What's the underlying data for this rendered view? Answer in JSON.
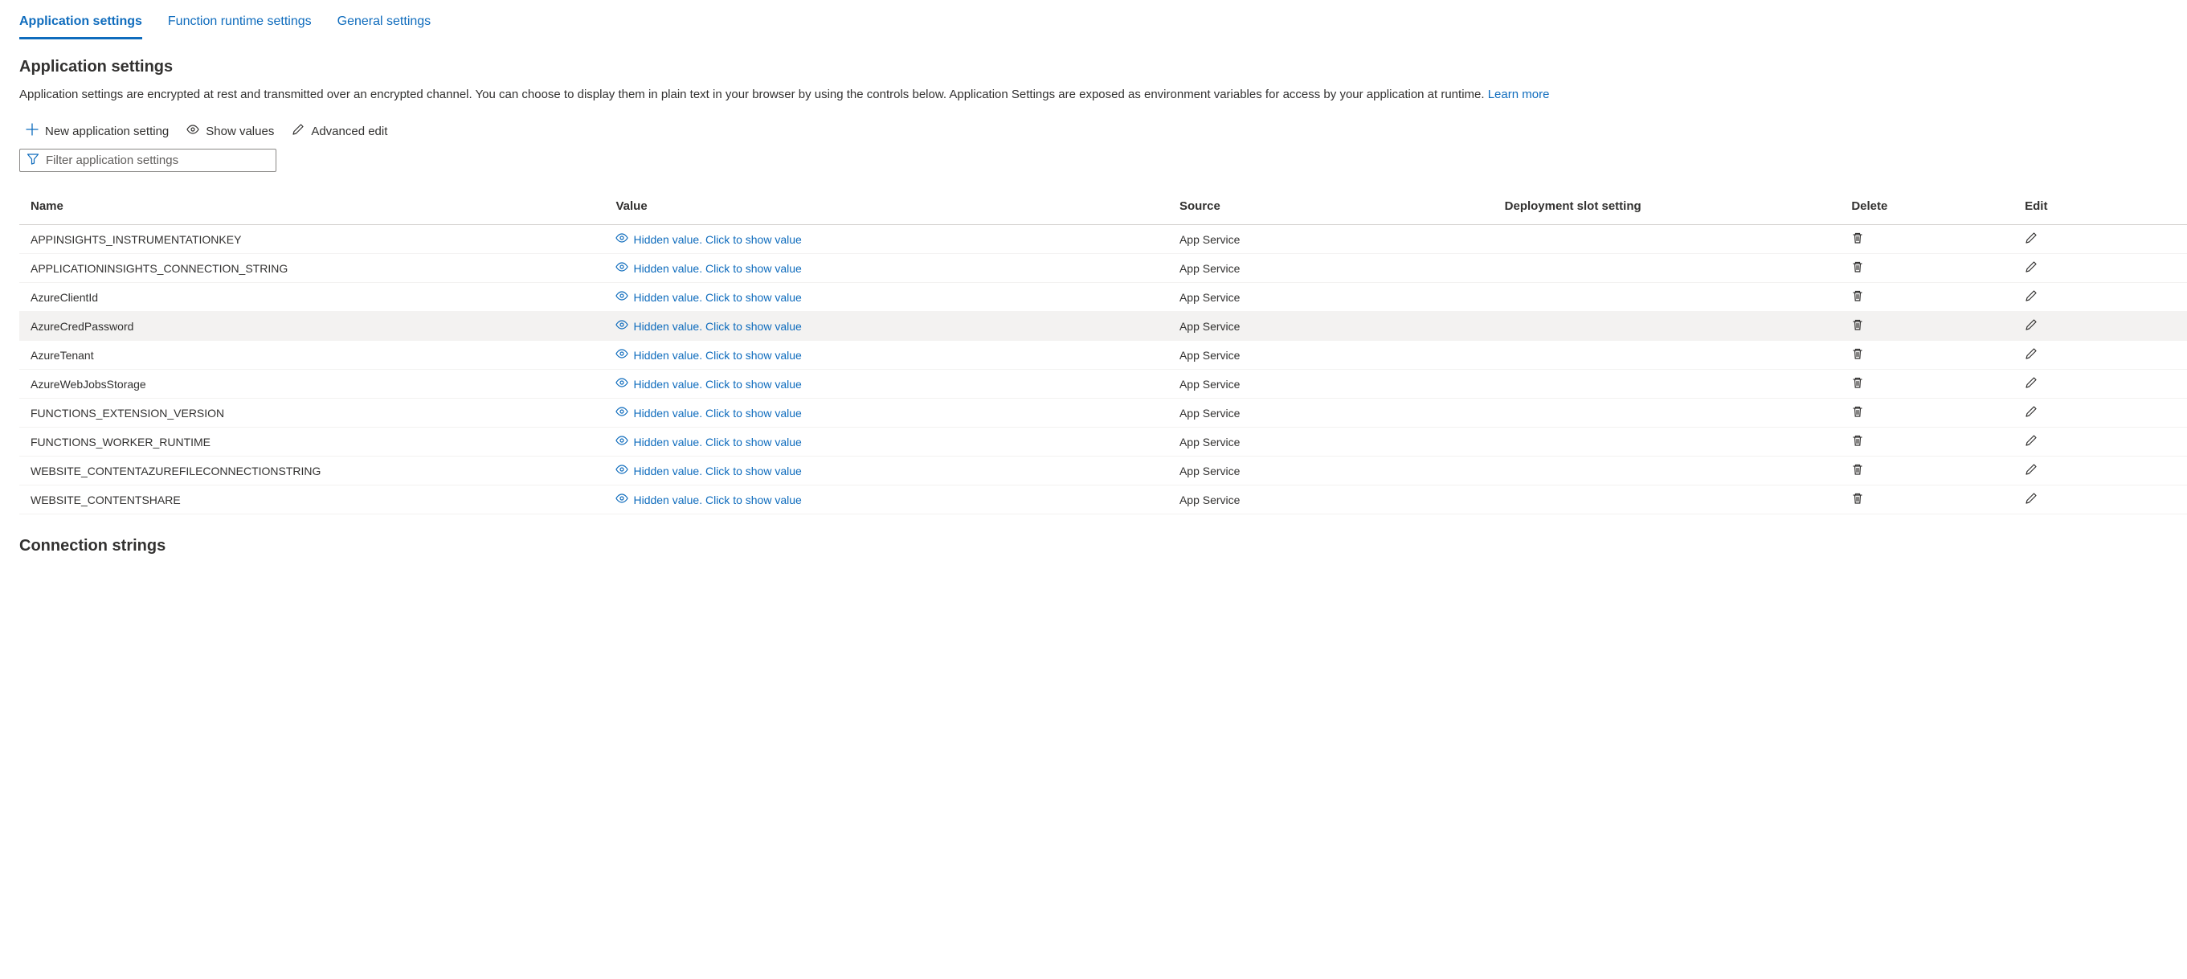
{
  "tabs": [
    {
      "label": "Application settings",
      "active": true
    },
    {
      "label": "Function runtime settings",
      "active": false
    },
    {
      "label": "General settings",
      "active": false
    }
  ],
  "section": {
    "title": "Application settings",
    "desc_text": "Application settings are encrypted at rest and transmitted over an encrypted channel. You can choose to display them in plain text in your browser by using the controls below. Application Settings are exposed as environment variables for access by your application at runtime. ",
    "learn_more": "Learn more"
  },
  "toolbar": {
    "new_setting": "New application setting",
    "show_values": "Show values",
    "advanced_edit": "Advanced edit"
  },
  "filter": {
    "placeholder": "Filter application settings"
  },
  "columns": {
    "name": "Name",
    "value": "Value",
    "source": "Source",
    "slot": "Deployment slot setting",
    "delete": "Delete",
    "edit": "Edit"
  },
  "hidden_value_text": "Hidden value. Click to show value",
  "rows": [
    {
      "name": "APPINSIGHTS_INSTRUMENTATIONKEY",
      "source": "App Service",
      "highlight": false
    },
    {
      "name": "APPLICATIONINSIGHTS_CONNECTION_STRING",
      "source": "App Service",
      "highlight": false
    },
    {
      "name": "AzureClientId",
      "source": "App Service",
      "highlight": false
    },
    {
      "name": "AzureCredPassword",
      "source": "App Service",
      "highlight": true
    },
    {
      "name": "AzureTenant",
      "source": "App Service",
      "highlight": false
    },
    {
      "name": "AzureWebJobsStorage",
      "source": "App Service",
      "highlight": false
    },
    {
      "name": "FUNCTIONS_EXTENSION_VERSION",
      "source": "App Service",
      "highlight": false
    },
    {
      "name": "FUNCTIONS_WORKER_RUNTIME",
      "source": "App Service",
      "highlight": false
    },
    {
      "name": "WEBSITE_CONTENTAZUREFILECONNECTIONSTRING",
      "source": "App Service",
      "highlight": false
    },
    {
      "name": "WEBSITE_CONTENTSHARE",
      "source": "App Service",
      "highlight": false
    }
  ],
  "connection_strings_title": "Connection strings"
}
